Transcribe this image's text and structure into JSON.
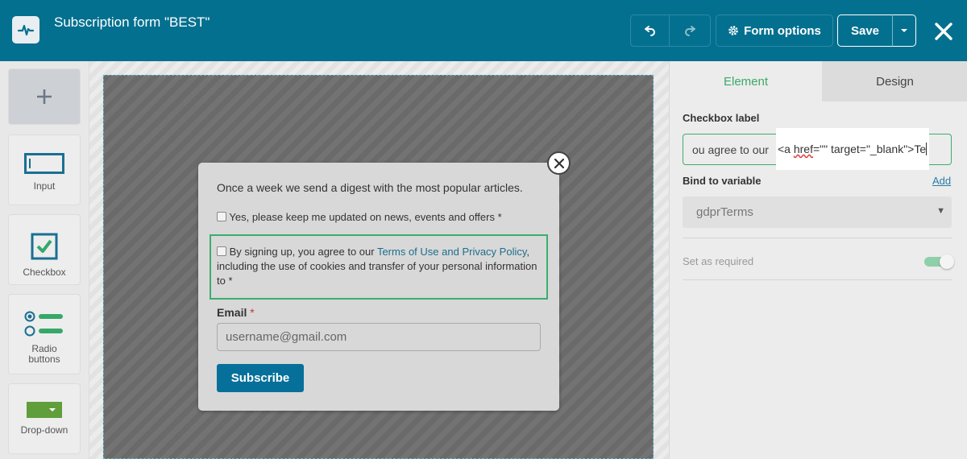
{
  "header": {
    "title": "Subscription form \"BEST\"",
    "form_options_label": "Form options",
    "save_label": "Save"
  },
  "toolbar": {
    "items": [
      {
        "label": "Input"
      },
      {
        "label": "Checkbox"
      },
      {
        "label": "Radio buttons"
      },
      {
        "label": "Drop-down"
      }
    ]
  },
  "form": {
    "digest_text": "Once a week we send a digest with the most popular articles.",
    "option1_label": "Yes, please keep me updated on news, events and offers *",
    "gdpr_prefix": "By signing up, you agree to our ",
    "gdpr_link": "Terms of Use and Privacy Policy",
    "gdpr_suffix": ", including the use of cookies and transfer of your personal information to  *",
    "email_label": "Email",
    "email_required_mark": "*",
    "email_placeholder": "username@gmail.com",
    "subscribe_label": "Subscribe"
  },
  "panel": {
    "tab_element": "Element",
    "tab_design": "Design",
    "checkbox_label_title": "Checkbox label",
    "checkbox_label_value_visible": "ou agree to our ",
    "checkbox_label_highlight_a": "<a ",
    "checkbox_label_highlight_href": "href",
    "checkbox_label_highlight_b": "=\"\" target=\"_blank\">Te",
    "bind_variable_title": "Bind to variable",
    "add_link": "Add",
    "variable_value": "gdprTerms",
    "set_required_label": "Set as required"
  },
  "colors": {
    "header_bg": "#04708f",
    "accent_green": "#3aae6e",
    "link_blue": "#1e6e8c"
  }
}
